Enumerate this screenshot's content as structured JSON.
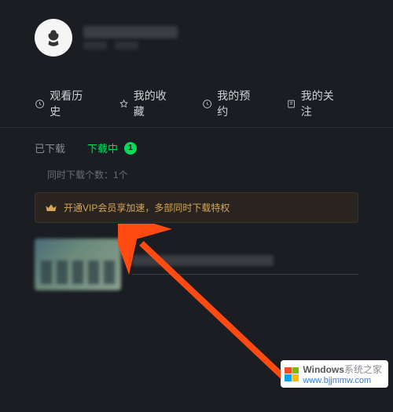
{
  "nav": {
    "history": "观看历史",
    "favorites": "我的收藏",
    "reservations": "我的预约",
    "follows": "我的关注"
  },
  "subnav": {
    "downloaded": "已下载",
    "downloading": "下载中",
    "downloading_count": "1"
  },
  "download_setting": "同时下载个数：1个",
  "vip_text": "开通VIP会员享加速，多部同时下载特权",
  "watermark": {
    "brand": "Windows",
    "tag": "系统之家",
    "site": "www.bjjmmw.com"
  }
}
